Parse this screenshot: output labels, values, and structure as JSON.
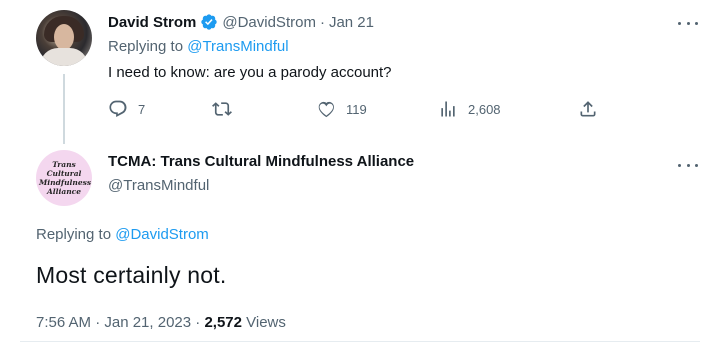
{
  "tweet1": {
    "author_name": "David Strom",
    "handle": "@DavidStrom",
    "date": "Jan 21",
    "replying_prefix": "Replying to ",
    "replying_to": "@TransMindful",
    "text": "I need to know: are you a parody account?",
    "replies": "7",
    "retweets": "",
    "likes": "119",
    "views": "2,608",
    "verified_color": "#1d9bf0"
  },
  "tweet2": {
    "author_name": "TCMA: Trans Cultural Mindfulness Alliance",
    "handle": "@TransMindful",
    "avatar_text": [
      "Trans",
      "Cultural",
      "Mindfulness",
      "Alliance"
    ],
    "replying_prefix": "Replying to ",
    "replying_to": "@DavidStrom",
    "text": "Most certainly not.",
    "time_date": "7:56 AM · Jan 21, 2023 · ",
    "views_count": "2,572",
    "views_label": " Views"
  },
  "colors": {
    "accent": "#1d9bf0",
    "secondary_text": "#536471",
    "primary_text": "#0f1419",
    "avatar2_bg": "#f4d7ef"
  }
}
